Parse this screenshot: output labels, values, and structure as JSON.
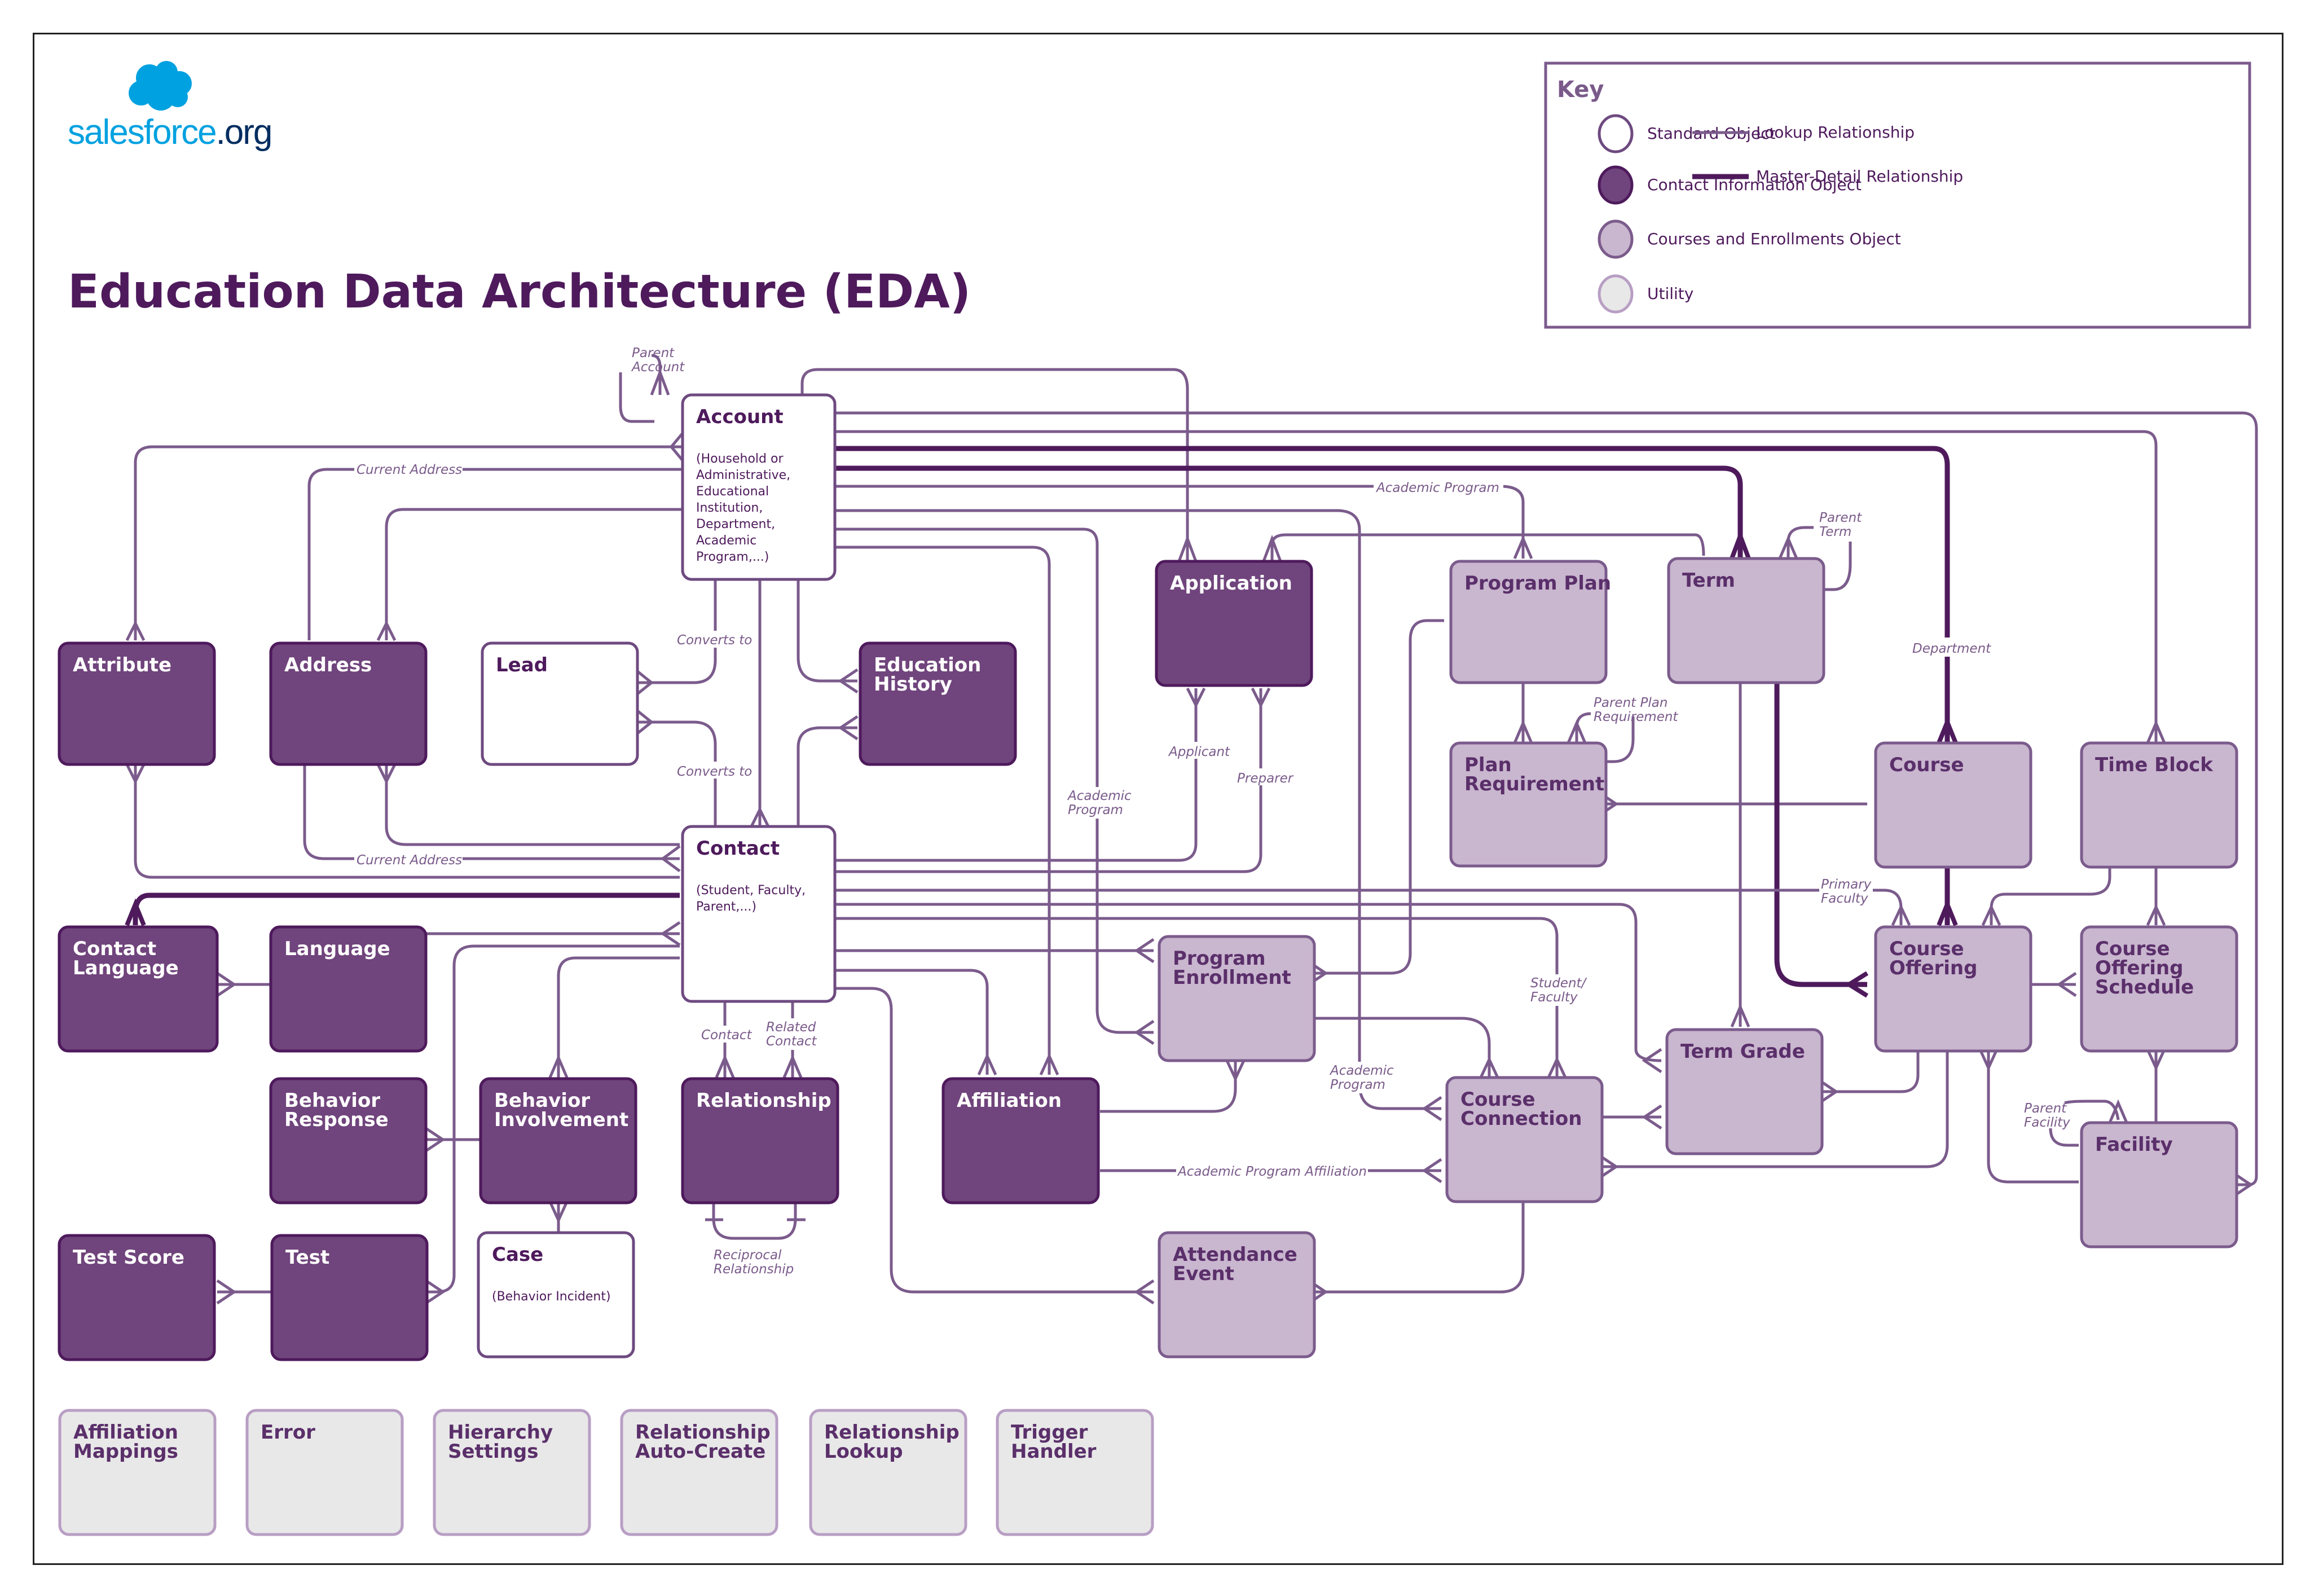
{
  "header": {
    "logo": {
      "text_main": "salesforce",
      "text_suffix": ".org",
      "icon": "salesforce-cloud-icon"
    },
    "title": "Education Data Architecture (EDA)"
  },
  "key": {
    "title": "Key",
    "object_types": [
      {
        "id": "standard",
        "label": "Standard Object"
      },
      {
        "id": "contact",
        "label": "Contact Information Object"
      },
      {
        "id": "course",
        "label": "Courses and Enrollments Object"
      },
      {
        "id": "utility",
        "label": "Utility"
      }
    ],
    "line_types": [
      {
        "id": "lookup",
        "label": "Lookup Relationship"
      },
      {
        "id": "master",
        "label": "Master-Detail Relationship"
      }
    ],
    "colors": {
      "standard_fill": "#ffffff",
      "contact_fill": "#70447c",
      "course_fill": "#c9b6cf",
      "utility_fill": "#e8e8e8",
      "lookup_line": "#7b5b8c",
      "master_line": "#4e1a5c"
    }
  },
  "objects": {
    "account": {
      "title": "Account",
      "subtitle": [
        "(Household or",
        "Administrative,",
        "Educational",
        "Institution,",
        "Department,",
        "Academic",
        "Program,...)"
      ],
      "type": "standard"
    },
    "contact": {
      "title": "Contact",
      "subtitle": [
        "(Student, Faculty,",
        "Parent,...)"
      ],
      "type": "standard"
    },
    "lead": {
      "title": "Lead",
      "subtitle": [],
      "type": "standard"
    },
    "case": {
      "title": "Case",
      "subtitle": [
        "(Behavior Incident)"
      ],
      "type": "standard"
    },
    "attribute": {
      "title": "Attribute",
      "type": "contact"
    },
    "address": {
      "title": "Address",
      "type": "contact"
    },
    "education_history": {
      "title": [
        "Education",
        "History"
      ],
      "type": "contact"
    },
    "application": {
      "title": "Application",
      "type": "contact"
    },
    "contact_language": {
      "title": [
        "Contact",
        "Language"
      ],
      "type": "contact"
    },
    "language": {
      "title": "Language",
      "type": "contact"
    },
    "behavior_response": {
      "title": [
        "Behavior",
        "Response"
      ],
      "type": "contact"
    },
    "behavior_involvement": {
      "title": [
        "Behavior",
        "Involvement"
      ],
      "type": "contact"
    },
    "relationship": {
      "title": "Relationship",
      "type": "contact"
    },
    "affiliation": {
      "title": "Affiliation",
      "type": "contact"
    },
    "test_score": {
      "title": "Test Score",
      "type": "contact"
    },
    "test": {
      "title": "Test",
      "type": "contact"
    },
    "program_plan": {
      "title": "Program Plan",
      "type": "course"
    },
    "plan_requirement": {
      "title": [
        "Plan",
        "Requirement"
      ],
      "type": "course"
    },
    "term": {
      "title": "Term",
      "type": "course"
    },
    "course": {
      "title": "Course",
      "type": "course"
    },
    "time_block": {
      "title": "Time Block",
      "type": "course"
    },
    "course_offering": {
      "title": [
        "Course",
        "Offering"
      ],
      "type": "course"
    },
    "course_offering_schedule": {
      "title": [
        "Course",
        "Offering",
        "Schedule"
      ],
      "type": "course"
    },
    "program_enrollment": {
      "title": [
        "Program",
        "Enrollment"
      ],
      "type": "course"
    },
    "course_connection": {
      "title": [
        "Course",
        "Connection"
      ],
      "type": "course"
    },
    "term_grade": {
      "title": "Term Grade",
      "type": "course"
    },
    "facility": {
      "title": "Facility",
      "type": "course"
    },
    "attendance_event": {
      "title": [
        "Attendance",
        "Event"
      ],
      "type": "course"
    },
    "affiliation_mappings": {
      "title": [
        "Affiliation",
        "Mappings"
      ],
      "type": "utility"
    },
    "error": {
      "title": "Error",
      "type": "utility"
    },
    "hierarchy_settings": {
      "title": [
        "Hierarchy",
        "Settings"
      ],
      "type": "utility"
    },
    "relationship_auto_create": {
      "title": [
        "Relationship",
        "Auto-Create"
      ],
      "type": "utility"
    },
    "relationship_lookup": {
      "title": [
        "Relationship",
        "Lookup"
      ],
      "type": "utility"
    },
    "trigger_handler": {
      "title": [
        "Trigger",
        "Handler"
      ],
      "type": "utility"
    }
  },
  "relationship_labels": {
    "parent_account": [
      "Parent",
      "Account"
    ],
    "current_address_top": "Current Address",
    "current_address_bottom": "Current Address",
    "converts_to_1": "Converts to",
    "converts_to_2": "Converts to",
    "academic_program_top": "Academic Program",
    "academic_program_pe": [
      "Academic",
      "Program"
    ],
    "academic_program_cc": [
      "Academic",
      "Program"
    ],
    "applicant": "Applicant",
    "preparer": "Preparer",
    "parent_term": [
      "Parent",
      "Term"
    ],
    "parent_plan_requirement": [
      "Parent Plan",
      "Requirement"
    ],
    "department": "Department",
    "primary_faculty": [
      "Primary",
      "Faculty"
    ],
    "student_faculty": [
      "Student/",
      "Faculty"
    ],
    "parent_facility": [
      "Parent",
      "Facility"
    ],
    "contact": "Contact",
    "related_contact": [
      "Related",
      "Contact"
    ],
    "reciprocal_relationship": [
      "Reciprocal",
      "Relationship"
    ],
    "academic_program_affiliation": "Academic Program Affiliation"
  }
}
